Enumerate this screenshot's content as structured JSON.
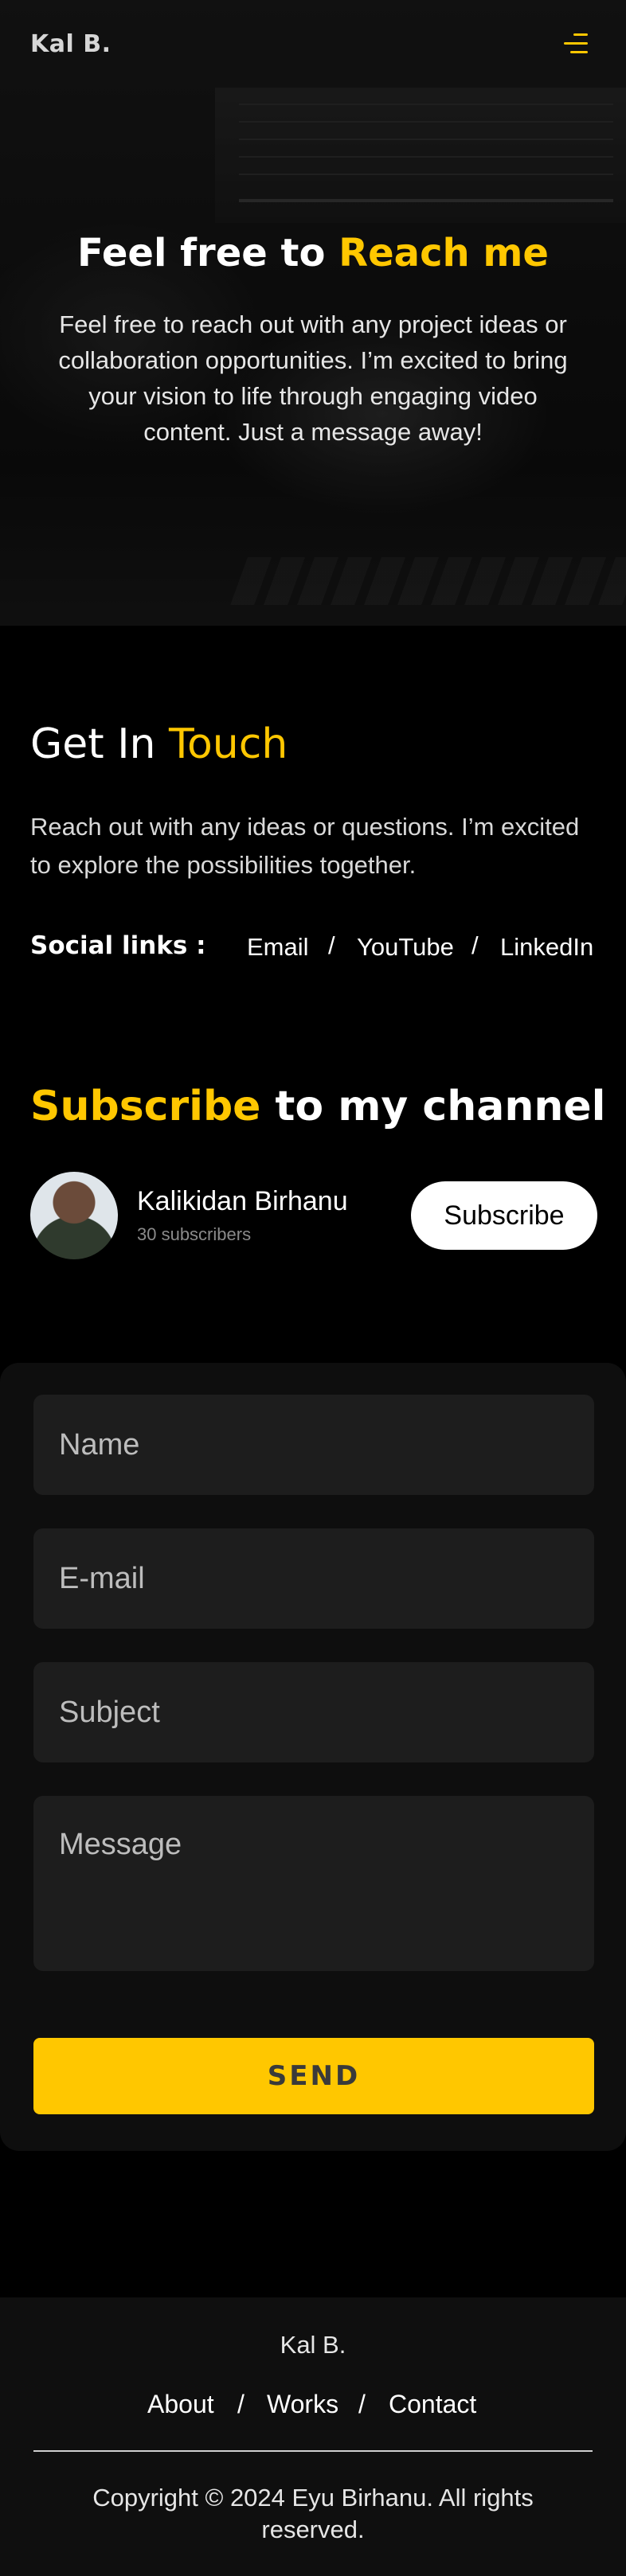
{
  "header": {
    "brand": "Kal B.",
    "menu_icon": "menu-icon"
  },
  "hero": {
    "title_plain": "Feel free to ",
    "title_highlight": "Reach me",
    "subtitle": "Feel free to reach out with any project ideas or collaboration opportunities. I’m excited to bring your vision to life through engaging video content. Just a message away!"
  },
  "contact": {
    "title_plain": "Get In ",
    "title_highlight": "Touch",
    "description": "Reach out with any ideas or questions. I’m excited to explore the possibilities together.",
    "social_label": "Social links :",
    "social_links": [
      "Email",
      "YouTube",
      "LinkedIn"
    ],
    "separator": "/"
  },
  "subscribe": {
    "title_highlight": "Subscribe",
    "title_plain": " to my channel",
    "channel_name": "Kalikidan Birhanu",
    "subscribers": "30 subscribers",
    "button_label": "Subscribe"
  },
  "form": {
    "name_placeholder": "Name",
    "email_placeholder": "E-mail",
    "subject_placeholder": "Subject",
    "message_placeholder": "Message",
    "send_label": "SEND"
  },
  "footer": {
    "brand": "Kal B.",
    "nav": [
      "About",
      "Works",
      "Contact"
    ],
    "separator": "/",
    "copyright": "Copyright © 2024 Eyu Birhanu. All rights reserved."
  },
  "colors": {
    "accent": "#ffc700",
    "background": "#000000"
  }
}
